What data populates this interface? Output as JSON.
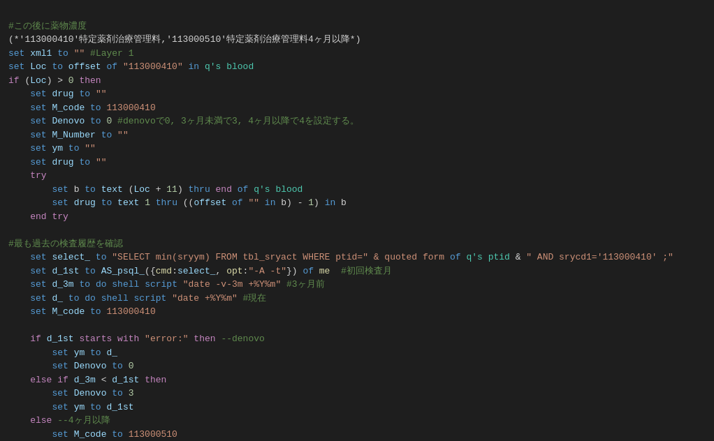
{
  "code": {
    "lines": []
  },
  "colors": {
    "background": "#1e1e1e",
    "keyword": "#569cd6",
    "comment": "#608b4e",
    "string": "#ce9178",
    "variable": "#9cdcfe",
    "function": "#dcdcaa",
    "control": "#c586c0",
    "number": "#b5cea8",
    "teal": "#4ec9b0"
  }
}
